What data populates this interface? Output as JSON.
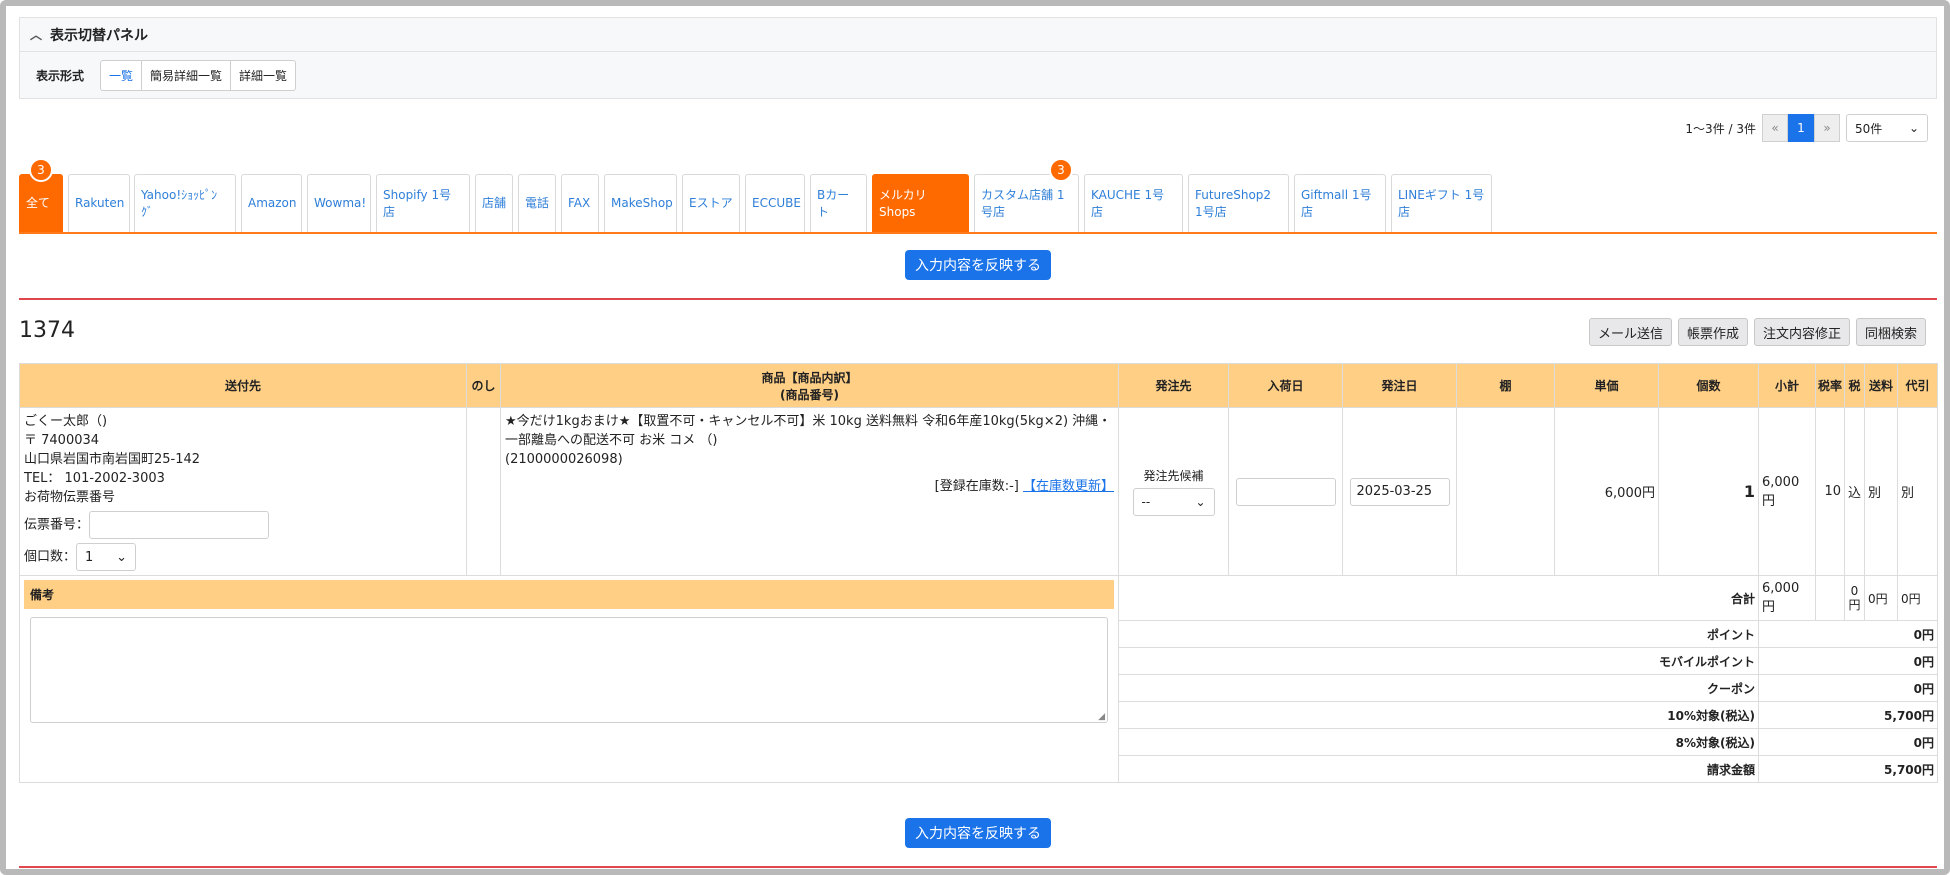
{
  "panel": {
    "title": "表示切替パネル",
    "format_label": "表示形式",
    "formats": [
      "一覧",
      "簡易詳細一覧",
      "詳細一覧"
    ]
  },
  "pager": {
    "count": "1〜3件 / 3件",
    "prev": "«",
    "current": "1",
    "next": "»",
    "per_page": "50件"
  },
  "tabs": [
    {
      "label": "全て",
      "badge": "3",
      "active": true
    },
    {
      "label": "Rakuten"
    },
    {
      "label": "Yahoo!ｼｮｯﾋﾟﾝｸﾞ"
    },
    {
      "label": "Amazon"
    },
    {
      "label": "Wowma!"
    },
    {
      "label": "Shopify 1号店"
    },
    {
      "label": "店舗"
    },
    {
      "label": "電話"
    },
    {
      "label": "FAX"
    },
    {
      "label": "MakeShop"
    },
    {
      "label": "Eストア"
    },
    {
      "label": "ECCUBE"
    },
    {
      "label": "Bカート"
    },
    {
      "label": "メルカリShops",
      "active": true
    },
    {
      "label": "カスタム店舗 1号店",
      "badge": "3"
    },
    {
      "label": "KAUCHE 1号店"
    },
    {
      "label": "FutureShop2 1号店"
    },
    {
      "label": "Giftmall 1号店"
    },
    {
      "label": "LINEギフト 1号店"
    }
  ],
  "apply_label": "入力内容を反映する",
  "order": {
    "number": "1374",
    "actions": [
      "メール送信",
      "帳票作成",
      "注文内容修正",
      "同梱検索"
    ]
  },
  "table": {
    "headers": {
      "dest": "送付先",
      "noshi": "のし",
      "product": "商品【商品内訳】",
      "product_sub": "(商品番号)",
      "supplier": "発注先",
      "arrival": "入荷日",
      "order_date": "発注日",
      "shelf": "棚",
      "unit_price": "単価",
      "qty": "個数",
      "subtotal": "小計",
      "tax_rate": "税率",
      "tax": "税",
      "shipping": "送料",
      "cod": "代引"
    },
    "dest": {
      "name": "ごくー太郎（)",
      "zip": "〒 7400034",
      "address": "山口県岩国市南岩国町25-142",
      "tel": "TEL： 101-2002-3003",
      "slip_title": "お荷物伝票番号",
      "slip_label": "伝票番号：",
      "boxes_label": "個口数：",
      "boxes_value": "1"
    },
    "product": {
      "name": "★今だけ1kgおまけ★【取置不可・キャンセル不可】米 10kg 送料無料 令和6年産10kg(5kg×2) 沖縄・一部離島への配送不可 お米 コメ （)",
      "code": "(2100000026098)",
      "stock_label": "[登録在庫数:-]",
      "stock_link": "【在庫数更新】"
    },
    "supplier_candidate": "発注先候補",
    "supplier_select": "--",
    "order_date": "2025-03-25",
    "unit_price": "6,000円",
    "qty": "1",
    "subtotal": "6,000円",
    "tax_rate": "10",
    "tax": "込",
    "shipping": "別",
    "cod": "別"
  },
  "notes_label": "備考",
  "summary": {
    "total_label": "合計",
    "total_subtotal": "6,000円",
    "total_tax": "0",
    "total_tax_unit": "円",
    "total_shipping": "0円",
    "total_cod": "0円",
    "rows": [
      {
        "label": "ポイント",
        "value": "0円"
      },
      {
        "label": "モバイルポイント",
        "value": "0円"
      },
      {
        "label": "クーポン",
        "value": "0円"
      },
      {
        "label": "10%対象(税込)",
        "value": "5,700円"
      },
      {
        "label": "8%対象(税込)",
        "value": "0円"
      },
      {
        "label": "請求金額",
        "value": "5,700円"
      }
    ]
  }
}
